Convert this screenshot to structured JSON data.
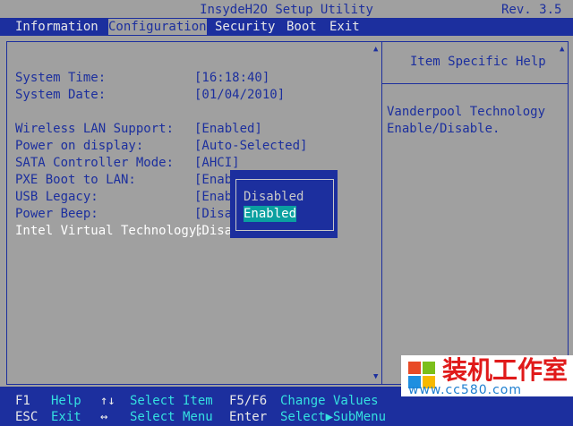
{
  "header": {
    "title": "InsydeH2O Setup Utility",
    "revision": "Rev. 3.5"
  },
  "menu": {
    "items": [
      "Information",
      "Configuration",
      "Security",
      "Boot",
      "Exit"
    ],
    "active": "Configuration"
  },
  "settings": [
    {
      "label": "System Time:",
      "value": "[16:18:40]"
    },
    {
      "label": "System Date:",
      "value": "[01/04/2010]"
    },
    {
      "label": "Wireless LAN Support:",
      "value": "[Enabled]"
    },
    {
      "label": "Power on display:",
      "value": "[Auto-Selected]"
    },
    {
      "label": "SATA Controller Mode:",
      "value": "[AHCI]"
    },
    {
      "label": "PXE Boot to LAN:",
      "value": "[Enab"
    },
    {
      "label": "USB Legacy:",
      "value": "[Enab"
    },
    {
      "label": "Power Beep:",
      "value": "[Disa"
    },
    {
      "label": "Intel Virtual Technology:",
      "value": "[Disa"
    }
  ],
  "popup": {
    "options": [
      "Disabled",
      "Enabled"
    ],
    "highlighted": "Enabled"
  },
  "help": {
    "title": "Item Specific Help",
    "lines": [
      "Vanderpool Technology",
      "Enable/Disable."
    ]
  },
  "footer": {
    "row1": [
      {
        "key": "F1",
        "desc": "Help"
      },
      {
        "key": "↑↓",
        "desc": "Select Item"
      },
      {
        "key": "F5/F6",
        "desc": "Change Values"
      }
    ],
    "row2": [
      {
        "key": "ESC",
        "desc": "Exit"
      },
      {
        "key": "↔",
        "desc": "Select Menu"
      },
      {
        "key": "Enter",
        "desc": "Select▶SubMenu"
      }
    ]
  },
  "watermark": {
    "text": "装机工作室",
    "url": "www.cc580.com"
  },
  "colors": {
    "bios_blue": "#1c2f9e",
    "bios_gray": "#a0a0a0",
    "highlight_teal": "#0aa0a0",
    "logo_red": "#e01a1a"
  }
}
